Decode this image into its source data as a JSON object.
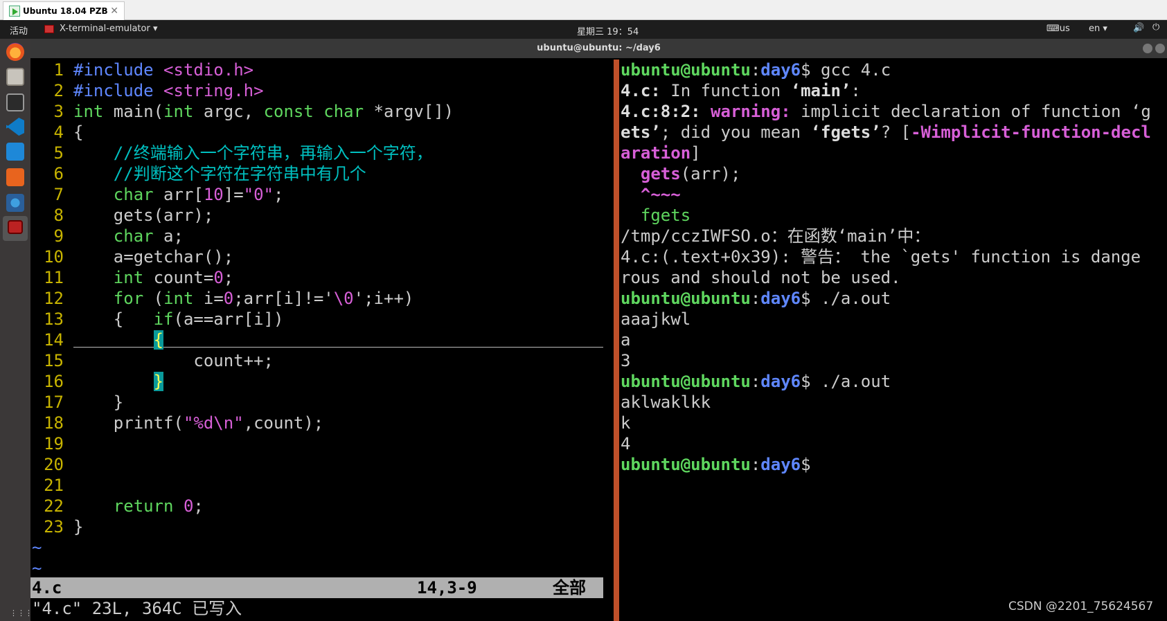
{
  "vm_tab": {
    "title": "Ubuntu 18.04 PZB",
    "close": "✕"
  },
  "topbar": {
    "activities": "活动",
    "app_menu": "X-terminal-emulator ▾",
    "clock": "星期三 19：54",
    "keyboard": "⌨us",
    "language": "en ▾",
    "volume": "🔊",
    "power": "⏻"
  },
  "window": {
    "title": "ubuntu@ubuntu: ~/day6"
  },
  "dock": {
    "items": [
      "firefox-icon",
      "files-icon",
      "terminal-icon",
      "vscode-icon",
      "vnote-icon",
      "software-icon",
      "settings-icon",
      "terminal-active-icon"
    ],
    "grid": "⋮⋮⋮"
  },
  "editor": {
    "lines": [
      {
        "n": "1"
      },
      {
        "n": "2"
      },
      {
        "n": "3"
      },
      {
        "n": "4"
      },
      {
        "n": "5"
      },
      {
        "n": "6"
      },
      {
        "n": "7"
      },
      {
        "n": "8"
      },
      {
        "n": "9"
      },
      {
        "n": "10"
      },
      {
        "n": "11"
      },
      {
        "n": "12"
      },
      {
        "n": "13"
      },
      {
        "n": "14"
      },
      {
        "n": "15"
      },
      {
        "n": "16"
      },
      {
        "n": "17"
      },
      {
        "n": "18"
      },
      {
        "n": "19"
      },
      {
        "n": "20"
      },
      {
        "n": "21"
      },
      {
        "n": "22"
      },
      {
        "n": "23"
      }
    ],
    "code": {
      "l1_a": "#include",
      "l1_b": " <stdio.h>",
      "l2_a": "#include",
      "l2_b": " <string.h>",
      "l3_a": "int",
      "l3_b": " main(",
      "l3_c": "int",
      "l3_d": " argc, ",
      "l3_e": "const char",
      "l3_f": " *argv[])",
      "l4": "{",
      "l5": "    //终端输入一个字符串，再输入一个字符，",
      "l6": "    //判断这个字符在字符串中有几个",
      "l7_a": "    ",
      "l7_b": "char",
      "l7_c": " arr[",
      "l7_d": "10",
      "l7_e": "]=",
      "l7_f": "\"0\"",
      "l7_g": ";",
      "l8": "    gets(arr);",
      "l9_a": "    ",
      "l9_b": "char",
      "l9_c": " a;",
      "l10": "    a=getchar();",
      "l11_a": "    ",
      "l11_b": "int",
      "l11_c": " count=",
      "l11_d": "0",
      "l11_e": ";",
      "l12_a": "    ",
      "l12_b": "for",
      "l12_c": " (",
      "l12_d": "int",
      "l12_e": " i=",
      "l12_f": "0",
      "l12_g": ";arr[i]!='",
      "l12_h": "\\0",
      "l12_i": "';i++)",
      "l13_a": "    {   ",
      "l13_b": "if",
      "l13_c": "(a==arr[i])",
      "l14_a": "        ",
      "l14_b": "{",
      "l15": "            count++;",
      "l16_a": "        ",
      "l16_b": "}",
      "l17": "    }",
      "l18_a": "    printf(",
      "l18_b": "\"%d\\n\"",
      "l18_c": ",count);",
      "l19": "",
      "l20": "",
      "l21": "",
      "l22_a": "    ",
      "l22_b": "return",
      "l22_c": " ",
      "l22_d": "0",
      "l22_e": ";",
      "l23": "}"
    },
    "tildes": [
      "~",
      "~"
    ],
    "status": {
      "file": "4.c",
      "position": "14,3-9",
      "scope": "全部"
    },
    "cmdline": "\"4.c\" 23L, 364C 已写入"
  },
  "terminal": {
    "prompt_user": "ubuntu@ubuntu",
    "prompt_colon": ":",
    "prompt_dir": "day6",
    "prompt_end": "$",
    "cmd1": " gcc 4.c",
    "l2_a": "4.c:",
    "l2_b": " In function ",
    "l2_c": "‘main’",
    "l2_d": ":",
    "l3_a": "4.c:8:2:",
    "l3_b": " warning:",
    "l3_c": " implicit declaration of function ‘g",
    "l4_a": "ets’",
    "l4_b": "; did you mean ",
    "l4_c": "‘fgets’",
    "l4_d": "? [",
    "l4_e": "-Wimplicit-function-decl",
    "l5_a": "aration",
    "l5_b": "]",
    "l6_a": "  ",
    "l6_b": "gets",
    "l6_c": "(arr);",
    "l7": "  ^~~~",
    "l8": "  fgets",
    "l9": "/tmp/cczIWFSO.o：在函数‘main’中：",
    "l10": "4.c:(.text+0x39): 警告： the `gets' function is dange",
    "l11": "rous and should not be used.",
    "cmd2": " ./a.out",
    "out1": "aaajkwl",
    "out2": "a",
    "out3": "3",
    "cmd3": " ./a.out",
    "out4": "aklwaklkk",
    "out5": "k",
    "out6": "4"
  },
  "watermark": "CSDN @2201_75624567"
}
